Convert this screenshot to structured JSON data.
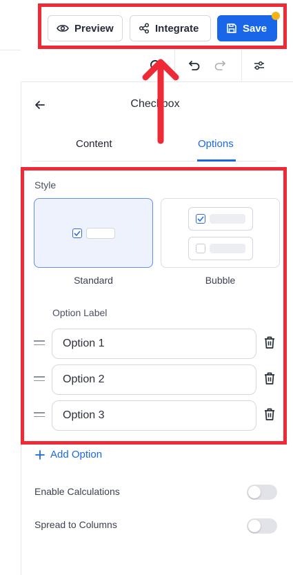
{
  "toolbar": {
    "preview_label": "Preview",
    "integrate_label": "Integrate",
    "save_label": "Save"
  },
  "panel": {
    "title": "Checkbox",
    "tabs": [
      {
        "label": "Content",
        "active": false
      },
      {
        "label": "Options",
        "active": true
      }
    ]
  },
  "style": {
    "section_label": "Style",
    "options": [
      {
        "label": "Standard",
        "selected": true
      },
      {
        "label": "Bubble",
        "selected": false
      }
    ]
  },
  "options_list": {
    "header": "Option Label",
    "items": [
      {
        "value": "Option 1"
      },
      {
        "value": "Option 2"
      },
      {
        "value": "Option 3"
      }
    ],
    "add_label": "Add Option"
  },
  "settings": [
    {
      "label": "Enable Calculations",
      "enabled": false
    },
    {
      "label": "Spread to Columns",
      "enabled": false
    }
  ],
  "colors": {
    "accent": "#1967e8",
    "highlight_box": "#ee2a36",
    "notification_dot": "#f2b21a"
  }
}
